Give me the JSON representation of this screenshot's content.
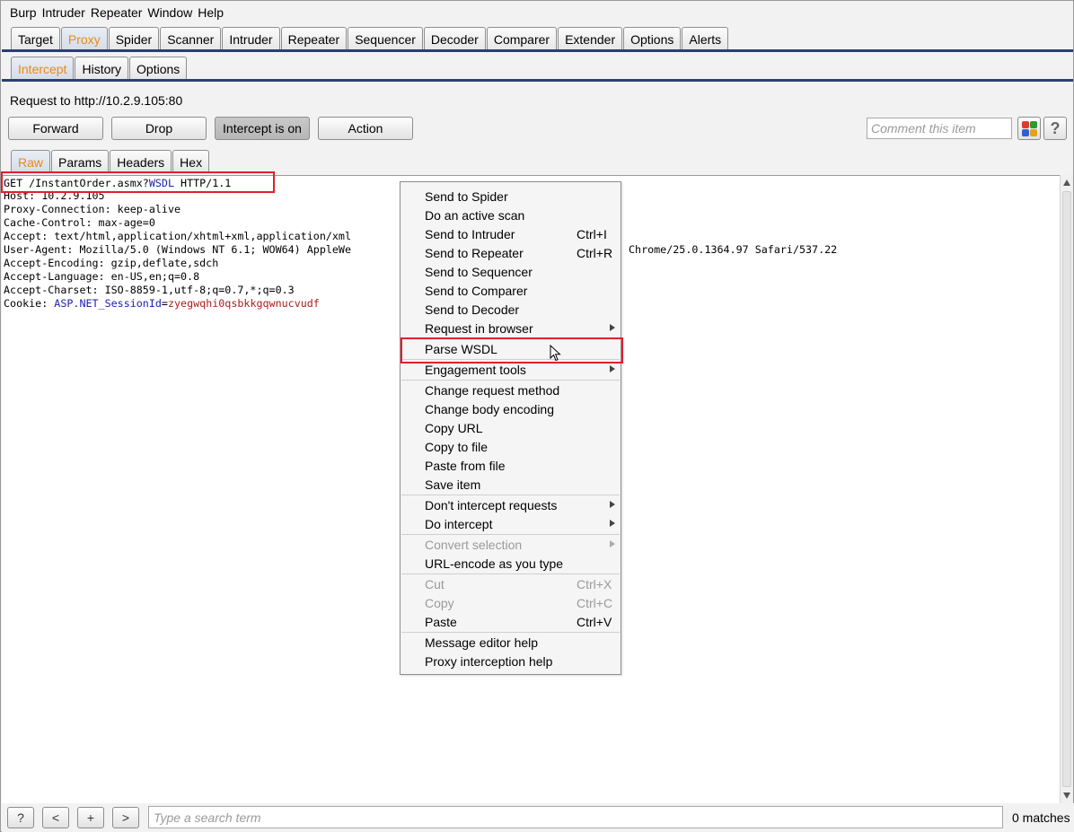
{
  "menubar": [
    "Burp",
    "Intruder",
    "Repeater",
    "Window",
    "Help"
  ],
  "main_tabs": [
    "Target",
    "Proxy",
    "Spider",
    "Scanner",
    "Intruder",
    "Repeater",
    "Sequencer",
    "Decoder",
    "Comparer",
    "Extender",
    "Options",
    "Alerts"
  ],
  "main_tab_active": "Proxy",
  "proxy_tabs": [
    "Intercept",
    "History",
    "Options"
  ],
  "proxy_tab_active": "Intercept",
  "request_label": "Request to http://10.2.9.105:80",
  "buttons": {
    "forward": "Forward",
    "drop": "Drop",
    "intercept": "Intercept is on",
    "action": "Action"
  },
  "comment_placeholder": "Comment this item",
  "help_label": "?",
  "highlight_colors": [
    "#e03a2f",
    "#2f9a2f",
    "#2f5fd0",
    "#e6a21c"
  ],
  "editor_tabs": [
    "Raw",
    "Params",
    "Headers",
    "Hex"
  ],
  "editor_tab_active": "Raw",
  "request": {
    "line1_a": "GET /InstantOrder.asmx?",
    "line1_b": "WSDL",
    "line1_c": " HTTP/1.1",
    "host": "Host: 10.2.9.105",
    "proxy_conn": "Proxy-Connection: keep-alive",
    "cache": "Cache-Control: max-age=0",
    "accept": "Accept: text/html,application/xhtml+xml,application/xml",
    "ua_a": "User-Agent: Mozilla/5.0 (Windows NT 6.1; WOW64) AppleWe",
    "ua_b": "Chrome/25.0.1364.97 Safari/537.22",
    "enc": "Accept-Encoding: gzip,deflate,sdch",
    "lang": "Accept-Language: en-US,en;q=0.8",
    "charset": "Accept-Charset: ISO-8859-1,utf-8;q=0.7,*;q=0.3",
    "cookie_a": "Cookie: ",
    "cookie_name": "ASP.NET_SessionId",
    "cookie_eq": "=",
    "cookie_val": "zyegwqhi0qsbkkgqwnucvudf"
  },
  "context_menu": {
    "send_spider": "Send to Spider",
    "active_scan": "Do an active scan",
    "send_intruder": "Send to Intruder",
    "send_intruder_sc": "Ctrl+I",
    "send_repeater": "Send to Repeater",
    "send_repeater_sc": "Ctrl+R",
    "send_sequencer": "Send to Sequencer",
    "send_comparer": "Send to Comparer",
    "send_decoder": "Send to Decoder",
    "request_browser": "Request in browser",
    "parse_wsdl": "Parse WSDL",
    "engagement": "Engagement tools",
    "change_method": "Change request method",
    "change_encoding": "Change body encoding",
    "copy_url": "Copy URL",
    "copy_file": "Copy to file",
    "paste_file": "Paste from file",
    "save_item": "Save item",
    "dont_intercept": "Don't intercept requests",
    "do_intercept": "Do intercept",
    "convert_sel": "Convert selection",
    "url_encode": "URL-encode as you type",
    "cut": "Cut",
    "cut_sc": "Ctrl+X",
    "copy": "Copy",
    "copy_sc": "Ctrl+C",
    "paste": "Paste",
    "paste_sc": "Ctrl+V",
    "editor_help": "Message editor help",
    "proxy_help": "Proxy interception help"
  },
  "search": {
    "help": "?",
    "prev": "<",
    "add": "+",
    "next": ">",
    "placeholder": "Type a search term",
    "matches": "0 matches"
  }
}
